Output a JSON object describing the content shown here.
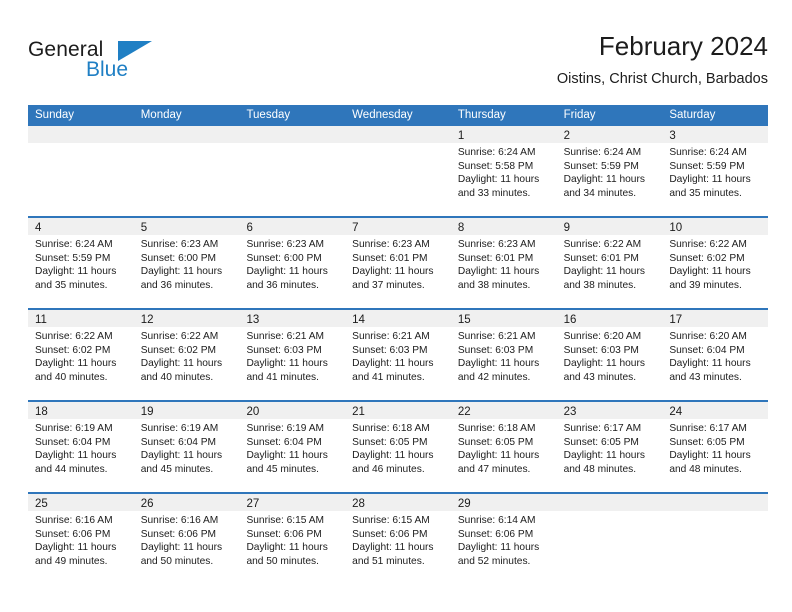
{
  "brand": {
    "name_part1": "General",
    "name_part2": "Blue",
    "flag_icon": "triangle-flag-icon",
    "accent_color": "#1f7fc4"
  },
  "header": {
    "title": "February 2024",
    "subtitle": "Oistins, Christ Church, Barbados"
  },
  "theme": {
    "header_blue": "#2f76bb",
    "day_band_gray": "#f0f0f0",
    "text_color": "#1c1c1c"
  },
  "weekdays": [
    "Sunday",
    "Monday",
    "Tuesday",
    "Wednesday",
    "Thursday",
    "Friday",
    "Saturday"
  ],
  "weeks": [
    [
      {
        "day": "",
        "lines": []
      },
      {
        "day": "",
        "lines": []
      },
      {
        "day": "",
        "lines": []
      },
      {
        "day": "",
        "lines": []
      },
      {
        "day": "1",
        "lines": [
          "Sunrise: 6:24 AM",
          "Sunset: 5:58 PM",
          "Daylight: 11 hours",
          "and 33 minutes."
        ]
      },
      {
        "day": "2",
        "lines": [
          "Sunrise: 6:24 AM",
          "Sunset: 5:59 PM",
          "Daylight: 11 hours",
          "and 34 minutes."
        ]
      },
      {
        "day": "3",
        "lines": [
          "Sunrise: 6:24 AM",
          "Sunset: 5:59 PM",
          "Daylight: 11 hours",
          "and 35 minutes."
        ]
      }
    ],
    [
      {
        "day": "4",
        "lines": [
          "Sunrise: 6:24 AM",
          "Sunset: 5:59 PM",
          "Daylight: 11 hours",
          "and 35 minutes."
        ]
      },
      {
        "day": "5",
        "lines": [
          "Sunrise: 6:23 AM",
          "Sunset: 6:00 PM",
          "Daylight: 11 hours",
          "and 36 minutes."
        ]
      },
      {
        "day": "6",
        "lines": [
          "Sunrise: 6:23 AM",
          "Sunset: 6:00 PM",
          "Daylight: 11 hours",
          "and 36 minutes."
        ]
      },
      {
        "day": "7",
        "lines": [
          "Sunrise: 6:23 AM",
          "Sunset: 6:01 PM",
          "Daylight: 11 hours",
          "and 37 minutes."
        ]
      },
      {
        "day": "8",
        "lines": [
          "Sunrise: 6:23 AM",
          "Sunset: 6:01 PM",
          "Daylight: 11 hours",
          "and 38 minutes."
        ]
      },
      {
        "day": "9",
        "lines": [
          "Sunrise: 6:22 AM",
          "Sunset: 6:01 PM",
          "Daylight: 11 hours",
          "and 38 minutes."
        ]
      },
      {
        "day": "10",
        "lines": [
          "Sunrise: 6:22 AM",
          "Sunset: 6:02 PM",
          "Daylight: 11 hours",
          "and 39 minutes."
        ]
      }
    ],
    [
      {
        "day": "11",
        "lines": [
          "Sunrise: 6:22 AM",
          "Sunset: 6:02 PM",
          "Daylight: 11 hours",
          "and 40 minutes."
        ]
      },
      {
        "day": "12",
        "lines": [
          "Sunrise: 6:22 AM",
          "Sunset: 6:02 PM",
          "Daylight: 11 hours",
          "and 40 minutes."
        ]
      },
      {
        "day": "13",
        "lines": [
          "Sunrise: 6:21 AM",
          "Sunset: 6:03 PM",
          "Daylight: 11 hours",
          "and 41 minutes."
        ]
      },
      {
        "day": "14",
        "lines": [
          "Sunrise: 6:21 AM",
          "Sunset: 6:03 PM",
          "Daylight: 11 hours",
          "and 41 minutes."
        ]
      },
      {
        "day": "15",
        "lines": [
          "Sunrise: 6:21 AM",
          "Sunset: 6:03 PM",
          "Daylight: 11 hours",
          "and 42 minutes."
        ]
      },
      {
        "day": "16",
        "lines": [
          "Sunrise: 6:20 AM",
          "Sunset: 6:03 PM",
          "Daylight: 11 hours",
          "and 43 minutes."
        ]
      },
      {
        "day": "17",
        "lines": [
          "Sunrise: 6:20 AM",
          "Sunset: 6:04 PM",
          "Daylight: 11 hours",
          "and 43 minutes."
        ]
      }
    ],
    [
      {
        "day": "18",
        "lines": [
          "Sunrise: 6:19 AM",
          "Sunset: 6:04 PM",
          "Daylight: 11 hours",
          "and 44 minutes."
        ]
      },
      {
        "day": "19",
        "lines": [
          "Sunrise: 6:19 AM",
          "Sunset: 6:04 PM",
          "Daylight: 11 hours",
          "and 45 minutes."
        ]
      },
      {
        "day": "20",
        "lines": [
          "Sunrise: 6:19 AM",
          "Sunset: 6:04 PM",
          "Daylight: 11 hours",
          "and 45 minutes."
        ]
      },
      {
        "day": "21",
        "lines": [
          "Sunrise: 6:18 AM",
          "Sunset: 6:05 PM",
          "Daylight: 11 hours",
          "and 46 minutes."
        ]
      },
      {
        "day": "22",
        "lines": [
          "Sunrise: 6:18 AM",
          "Sunset: 6:05 PM",
          "Daylight: 11 hours",
          "and 47 minutes."
        ]
      },
      {
        "day": "23",
        "lines": [
          "Sunrise: 6:17 AM",
          "Sunset: 6:05 PM",
          "Daylight: 11 hours",
          "and 48 minutes."
        ]
      },
      {
        "day": "24",
        "lines": [
          "Sunrise: 6:17 AM",
          "Sunset: 6:05 PM",
          "Daylight: 11 hours",
          "and 48 minutes."
        ]
      }
    ],
    [
      {
        "day": "25",
        "lines": [
          "Sunrise: 6:16 AM",
          "Sunset: 6:06 PM",
          "Daylight: 11 hours",
          "and 49 minutes."
        ]
      },
      {
        "day": "26",
        "lines": [
          "Sunrise: 6:16 AM",
          "Sunset: 6:06 PM",
          "Daylight: 11 hours",
          "and 50 minutes."
        ]
      },
      {
        "day": "27",
        "lines": [
          "Sunrise: 6:15 AM",
          "Sunset: 6:06 PM",
          "Daylight: 11 hours",
          "and 50 minutes."
        ]
      },
      {
        "day": "28",
        "lines": [
          "Sunrise: 6:15 AM",
          "Sunset: 6:06 PM",
          "Daylight: 11 hours",
          "and 51 minutes."
        ]
      },
      {
        "day": "29",
        "lines": [
          "Sunrise: 6:14 AM",
          "Sunset: 6:06 PM",
          "Daylight: 11 hours",
          "and 52 minutes."
        ]
      },
      {
        "day": "",
        "lines": []
      },
      {
        "day": "",
        "lines": []
      }
    ]
  ]
}
